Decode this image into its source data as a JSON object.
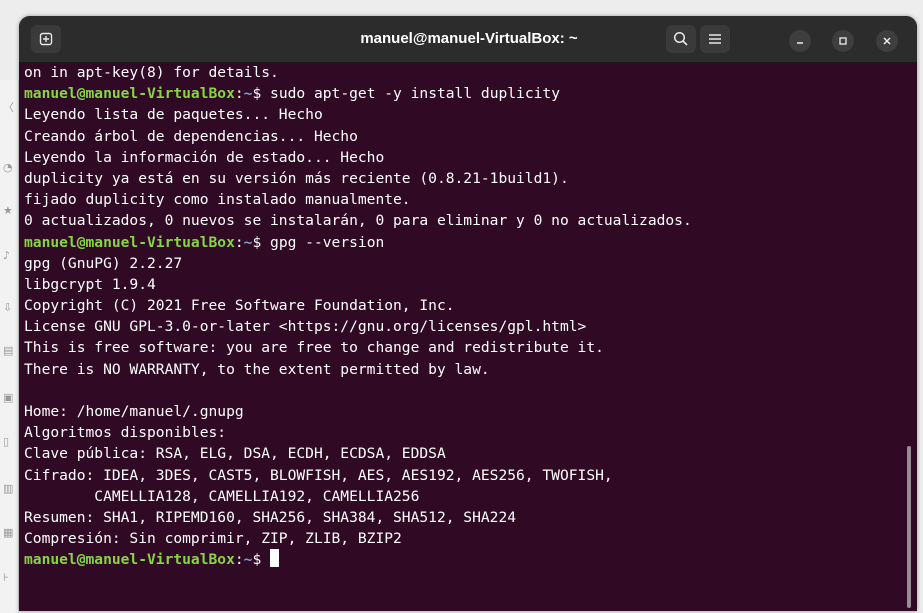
{
  "window": {
    "title": "manuel@manuel-VirtualBox: ~",
    "new_tab_icon": "new-tab-icon",
    "search_icon": "search-icon",
    "menu_icon": "hamburger-menu-icon"
  },
  "terminal": {
    "lines": [
      {
        "text": "on in apt-key(8) for details."
      },
      {
        "user": "manuel@manuel-VirtualBox",
        "sep": ":",
        "path": "~",
        "cmd": "$ sudo apt-get -y install duplicity"
      },
      {
        "text": "Leyendo lista de paquetes... Hecho"
      },
      {
        "text": "Creando árbol de dependencias... Hecho"
      },
      {
        "text": "Leyendo la información de estado... Hecho"
      },
      {
        "text": "duplicity ya está en su versión más reciente (0.8.21-1build1)."
      },
      {
        "text": "fijado duplicity como instalado manualmente."
      },
      {
        "text": "0 actualizados, 0 nuevos se instalarán, 0 para eliminar y 0 no actualizados."
      },
      {
        "user": "manuel@manuel-VirtualBox",
        "sep": ":",
        "path": "~",
        "cmd": "$ gpg --version"
      },
      {
        "text": "gpg (GnuPG) 2.2.27"
      },
      {
        "text": "libgcrypt 1.9.4"
      },
      {
        "text": "Copyright (C) 2021 Free Software Foundation, Inc."
      },
      {
        "text": "License GNU GPL-3.0-or-later <https://gnu.org/licenses/gpl.html>"
      },
      {
        "text": "This is free software: you are free to change and redistribute it."
      },
      {
        "text": "There is NO WARRANTY, to the extent permitted by law."
      },
      {
        "text": ""
      },
      {
        "text": "Home: /home/manuel/.gnupg"
      },
      {
        "text": "Algoritmos disponibles:"
      },
      {
        "text": "Clave pública: RSA, ELG, DSA, ECDH, ECDSA, EDDSA"
      },
      {
        "text": "Cifrado: IDEA, 3DES, CAST5, BLOWFISH, AES, AES192, AES256, TWOFISH,"
      },
      {
        "text": "        CAMELLIA128, CAMELLIA192, CAMELLIA256"
      },
      {
        "text": "Resumen: SHA1, RIPEMD160, SHA256, SHA384, SHA512, SHA224"
      },
      {
        "text": "Compresión: Sin comprimir, ZIP, ZLIB, BZIP2"
      }
    ],
    "prompt": {
      "user": "manuel@manuel-VirtualBox",
      "sep": ":",
      "path": "~",
      "cmd": "$ "
    }
  },
  "colors": {
    "background": "#300a24",
    "prompt_user": "#87d444",
    "prompt_path": "#7f9dd8",
    "text": "#ffffff"
  }
}
